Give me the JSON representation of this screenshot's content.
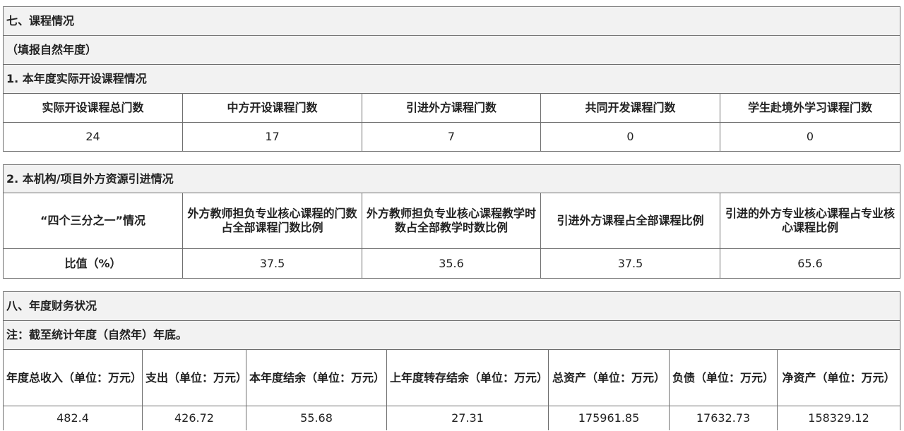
{
  "section7": {
    "title": "七、课程情况",
    "note": "（填报自然年度）",
    "sub1": {
      "title": "1. 本年度实际开设课程情况",
      "headers": [
        "实际开设课程总门数",
        "中方开设课程门数",
        "引进外方课程门数",
        "共同开发课程门数",
        "学生赴境外学习课程门数"
      ],
      "values": [
        "24",
        "17",
        "7",
        "0",
        "0"
      ]
    },
    "sub2": {
      "title": "2. 本机构/项目外方资源引进情况",
      "headers": [
        "“四个三分之一”情况",
        "外方教师担负专业核心课程的门数占全部课程门数比例",
        "外方教师担负专业核心课程教学时数占全部教学时数比例",
        "引进外方课程占全部课程比例",
        "引进的外方专业核心课程占专业核心课程比例"
      ],
      "row_label": "比值（%）",
      "values": [
        "37.5",
        "35.6",
        "37.5",
        "65.6"
      ]
    }
  },
  "section8": {
    "title": "八、年度财务状况",
    "note": "注：截至统计年度（自然年）年底。",
    "headers": [
      "年度总收入（单位：万元）",
      "支出（单位：万元）",
      "本年度结余（单位：万元）",
      "上年度转存结余（单位：万元）",
      "总资产（单位：万元）",
      "负债（单位：万元）",
      "净资产（单位：万元）"
    ],
    "values": [
      "482.4",
      "426.72",
      "55.68",
      "27.31",
      "175961.85",
      "17632.73",
      "158329.12"
    ]
  }
}
